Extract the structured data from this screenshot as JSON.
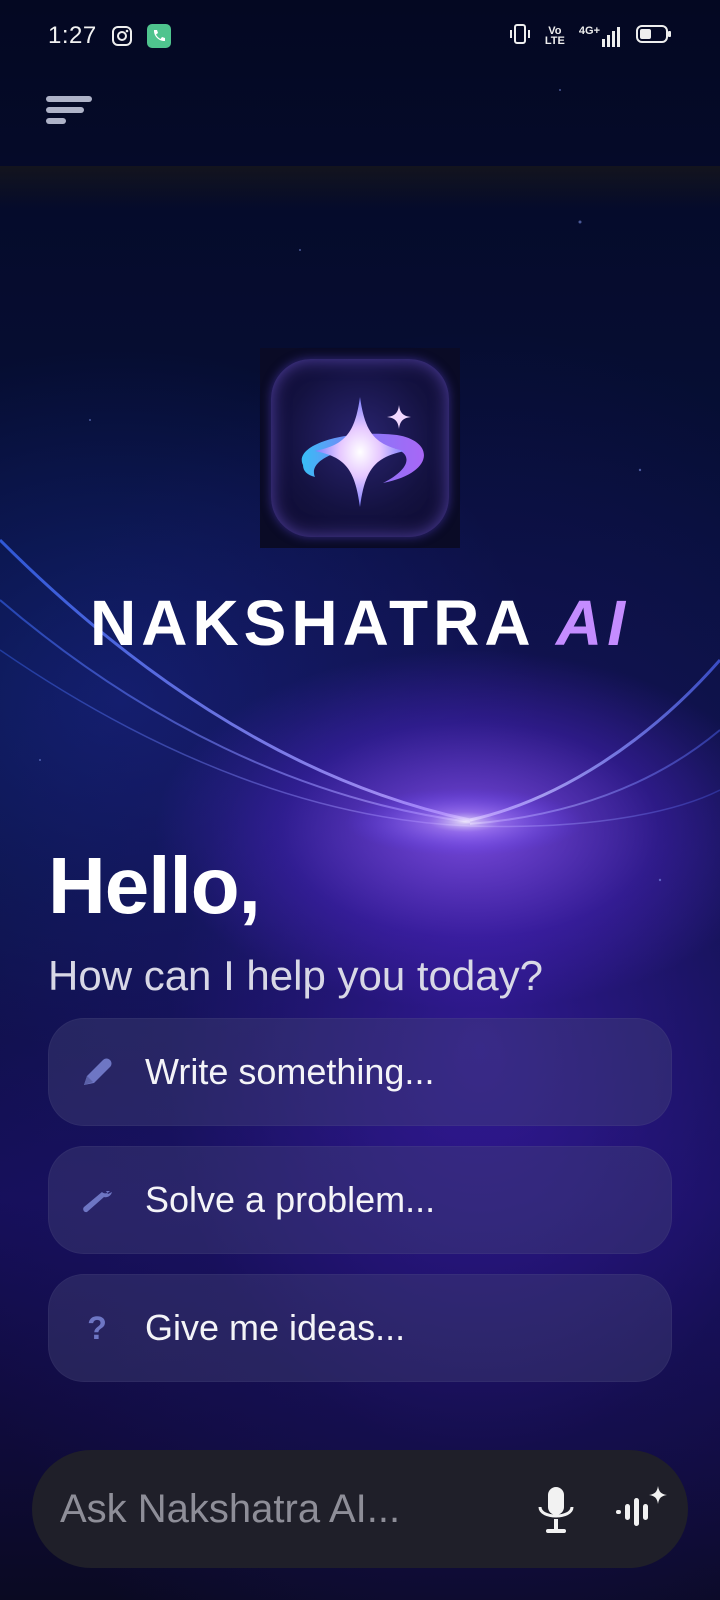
{
  "status_bar": {
    "time": "1:27",
    "icons": [
      "instagram-icon",
      "phone-call-icon",
      "vibrate-icon",
      "volte-icon",
      "4g-signal-icon",
      "battery-icon"
    ],
    "volte_label": "Vo LTE",
    "network_label": "4G+"
  },
  "app_bar": {
    "menu_icon": "menu-icon"
  },
  "brand": {
    "name_primary": "NAKSHATRA",
    "name_accent": "AI",
    "accent_color": "#c48cff"
  },
  "greeting": {
    "title": "Hello,",
    "subtitle": "How can I help you today?"
  },
  "suggestions": [
    {
      "label": "Write something...",
      "icon": "pencil-icon"
    },
    {
      "label": "Solve a problem...",
      "icon": "wrench-icon"
    },
    {
      "label": "Give me ideas...",
      "icon": "question-icon"
    }
  ],
  "composer": {
    "placeholder": "Ask Nakshatra AI...",
    "mic_icon": "microphone-icon",
    "voice_icon": "voice-mode-icon"
  },
  "colors": {
    "background": "#060a24",
    "chip_icon": "#6e76c4",
    "composer_bg": "#1f1f29"
  }
}
